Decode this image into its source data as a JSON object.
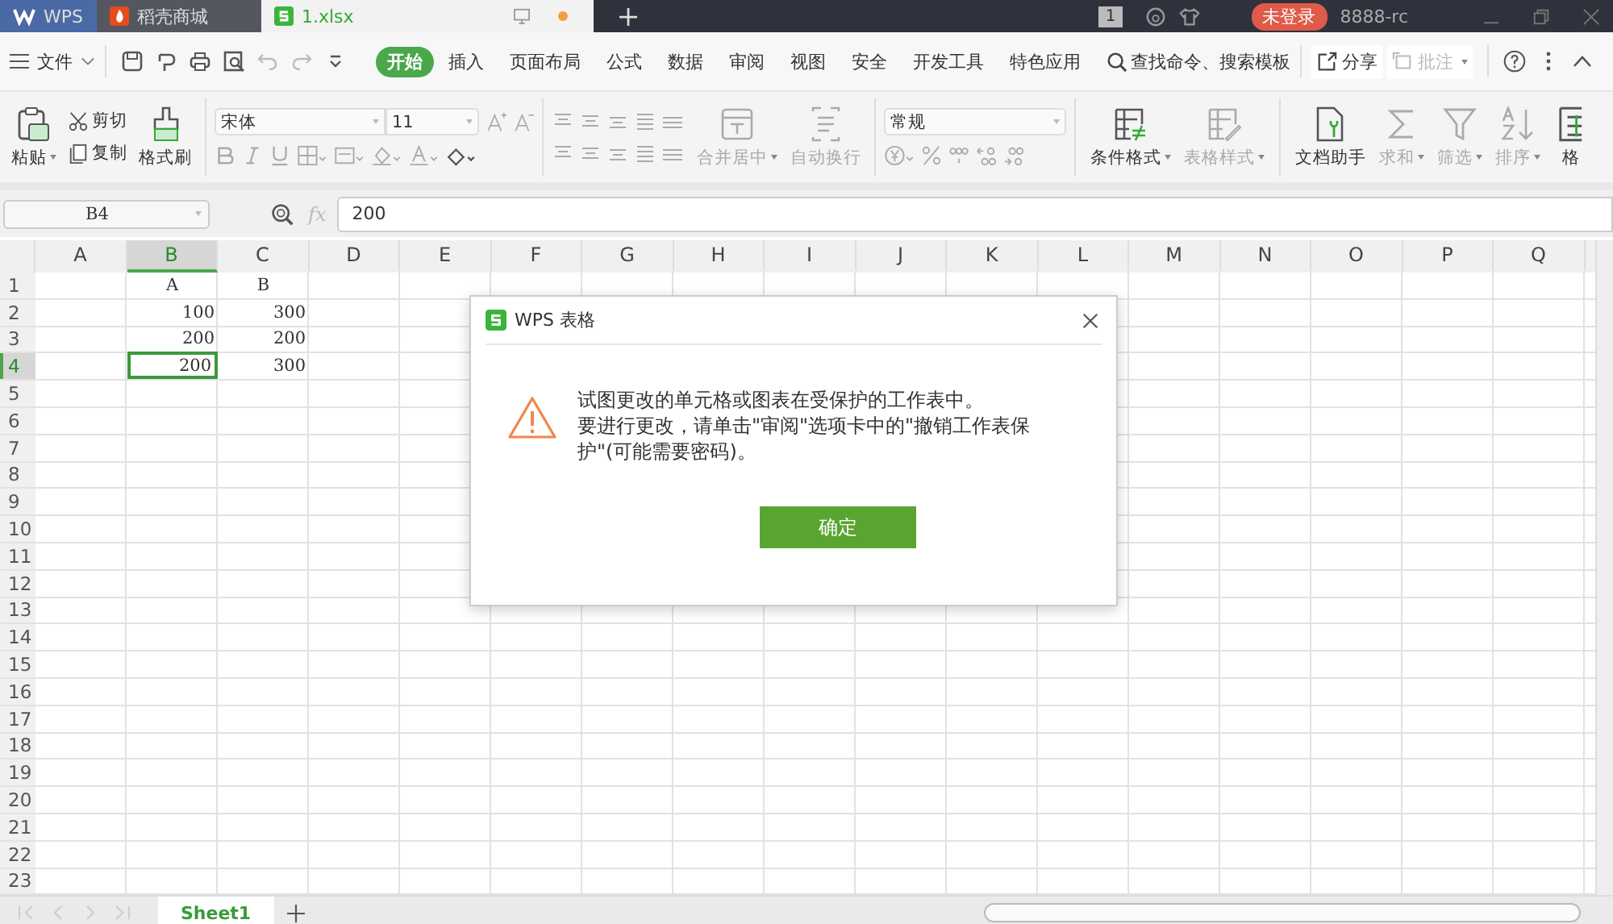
{
  "title_tabs": [
    {
      "kind": "wps",
      "label": "WPS",
      "selected": false
    },
    {
      "kind": "store",
      "label": "稻壳商城",
      "selected": false
    },
    {
      "kind": "sheet",
      "label": "1.xlsx",
      "selected": true
    }
  ],
  "title_bar": {
    "page_count": "1",
    "login": "未登录",
    "user": "8888-rc"
  },
  "menu": {
    "file": "文件",
    "tabs": [
      {
        "label": "开始",
        "selected": true
      },
      {
        "label": "插入",
        "selected": false
      },
      {
        "label": "页面布局",
        "selected": false
      },
      {
        "label": "公式",
        "selected": false
      },
      {
        "label": "数据",
        "selected": false
      },
      {
        "label": "审阅",
        "selected": false
      },
      {
        "label": "视图",
        "selected": false
      },
      {
        "label": "安全",
        "selected": false
      },
      {
        "label": "开发工具",
        "selected": false
      },
      {
        "label": "特色应用",
        "selected": false
      }
    ],
    "search": "查找命令、搜索模板",
    "share": "分享",
    "comment": {
      "label": "批注",
      "disabled": true
    }
  },
  "ribbon": {
    "paste": "粘贴",
    "cut": "剪切",
    "copy": "复制",
    "format_painter": "格式刷",
    "font_name": "宋体",
    "font_size": "11",
    "merge": {
      "label": "合并居中",
      "disabled": true
    },
    "wrap": {
      "label": "自动换行",
      "disabled": true
    },
    "number_format": "常规",
    "tools": [
      {
        "kind": "conditional",
        "label": "条件格式",
        "disabled": false,
        "dropdown": true
      },
      {
        "kind": "table-style",
        "label": "表格样式",
        "disabled": true,
        "dropdown": true
      },
      {
        "kind": "assistant",
        "label": "文档助手",
        "disabled": false,
        "dropdown": false
      },
      {
        "kind": "sum",
        "label": "求和",
        "disabled": true,
        "dropdown": true
      },
      {
        "kind": "filter",
        "label": "筛选",
        "disabled": true,
        "dropdown": true
      },
      {
        "kind": "sort",
        "label": "排序",
        "disabled": true,
        "dropdown": true
      },
      {
        "kind": "format",
        "label": "格",
        "disabled": false,
        "dropdown": false
      }
    ]
  },
  "formula_bar": {
    "cell": "B4",
    "fx": "fx",
    "value": "200"
  },
  "grid": {
    "columns": [
      {
        "label": "A",
        "selected": false
      },
      {
        "label": "B",
        "selected": true
      },
      {
        "label": "C",
        "selected": false
      },
      {
        "label": "D",
        "selected": false
      },
      {
        "label": "E",
        "selected": false
      },
      {
        "label": "F",
        "selected": false
      },
      {
        "label": "G",
        "selected": false
      },
      {
        "label": "H",
        "selected": false
      },
      {
        "label": "I",
        "selected": false
      },
      {
        "label": "J",
        "selected": false
      },
      {
        "label": "K",
        "selected": false
      },
      {
        "label": "L",
        "selected": false
      },
      {
        "label": "M",
        "selected": false
      },
      {
        "label": "N",
        "selected": false
      },
      {
        "label": "O",
        "selected": false
      },
      {
        "label": "P",
        "selected": false
      },
      {
        "label": "Q",
        "selected": false
      }
    ],
    "rows": [
      {
        "label": "1",
        "selected": false,
        "cells": {
          "B": {
            "text": "A",
            "kind": "text",
            "selected": false
          },
          "C": {
            "text": "B",
            "kind": "text",
            "selected": false
          }
        }
      },
      {
        "label": "2",
        "selected": false,
        "cells": {
          "B": {
            "text": "100",
            "kind": "number",
            "selected": false
          },
          "C": {
            "text": "300",
            "kind": "number",
            "selected": false
          }
        }
      },
      {
        "label": "3",
        "selected": false,
        "cells": {
          "B": {
            "text": "200",
            "kind": "number",
            "selected": false
          },
          "C": {
            "text": "200",
            "kind": "number",
            "selected": false
          }
        }
      },
      {
        "label": "4",
        "selected": true,
        "cells": {
          "B": {
            "text": "200",
            "kind": "number",
            "selected": true
          },
          "C": {
            "text": "300",
            "kind": "number",
            "selected": false
          }
        }
      },
      {
        "label": "5",
        "selected": false
      },
      {
        "label": "6",
        "selected": false
      },
      {
        "label": "7",
        "selected": false
      },
      {
        "label": "8",
        "selected": false
      },
      {
        "label": "9",
        "selected": false
      },
      {
        "label": "10",
        "selected": false
      },
      {
        "label": "11",
        "selected": false
      },
      {
        "label": "12",
        "selected": false
      },
      {
        "label": "13",
        "selected": false
      },
      {
        "label": "14",
        "selected": false
      },
      {
        "label": "15",
        "selected": false
      },
      {
        "label": "16",
        "selected": false
      },
      {
        "label": "17",
        "selected": false
      },
      {
        "label": "18",
        "selected": false
      },
      {
        "label": "19",
        "selected": false
      },
      {
        "label": "20",
        "selected": false
      },
      {
        "label": "21",
        "selected": false
      },
      {
        "label": "22",
        "selected": false
      },
      {
        "label": "23",
        "selected": false
      }
    ]
  },
  "sheet_tabs": [
    {
      "label": "Sheet1",
      "selected": true
    }
  ],
  "dialog": {
    "title": "WPS 表格",
    "message": [
      "试图更改的单元格或图表在受保护的工作表中。",
      "要进行更改，请单击\"审阅\"选项卡中的\"撤销工作表保护\"(可能需要密码)。"
    ],
    "ok": "确定"
  }
}
